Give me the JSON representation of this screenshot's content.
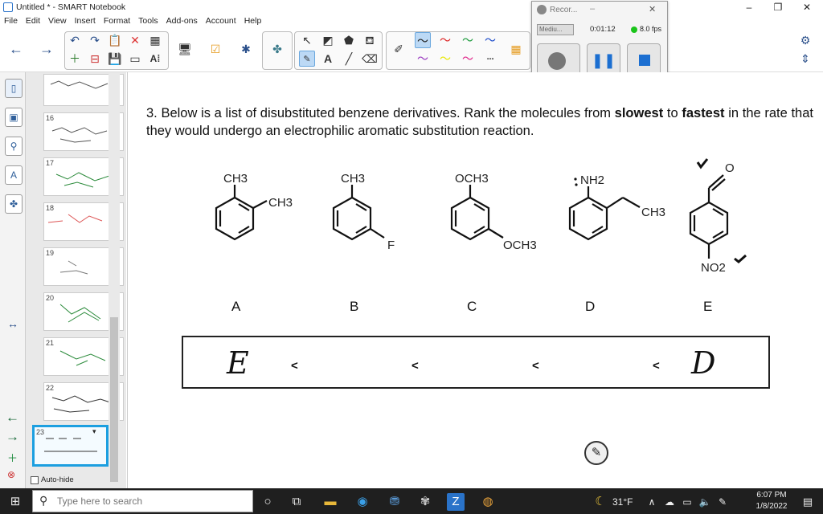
{
  "window": {
    "title": "Untitled * - SMART Notebook",
    "minimize": "–",
    "restore": "❐",
    "close": "✕"
  },
  "menu": [
    "File",
    "Edit",
    "View",
    "Insert",
    "Format",
    "Tools",
    "Add-ons",
    "Account",
    "Help"
  ],
  "recorder": {
    "title": "Recor...",
    "dropdown": "Mediu...",
    "time": "0:01:12",
    "fps": "8.0 fps",
    "minimize": "–",
    "close": "✕"
  },
  "slides": [
    "16",
    "17",
    "18",
    "19",
    "20",
    "21",
    "22",
    "23"
  ],
  "sorter": {
    "autohide_label": "Auto-hide"
  },
  "question": {
    "number": "3.",
    "part1": "Below is a list of disubstituted benzene derivatives. Rank the molecules from",
    "bold1": "slowest",
    "part2": "to",
    "bold2": "fastest",
    "part3": "in the rate that they would undergo an electrophilic aromatic substitution reaction."
  },
  "molecules": [
    {
      "label": "A",
      "sub1": "CH3",
      "sub2": "CH3"
    },
    {
      "label": "B",
      "sub1": "CH3",
      "sub2": "F"
    },
    {
      "label": "C",
      "sub1": "OCH3",
      "sub2": "OCH3"
    },
    {
      "label": "D",
      "sub1": "NH2",
      "sub2": "CH3"
    },
    {
      "label": "E",
      "sub1": "O",
      "sub2": "NO2"
    }
  ],
  "ranking": {
    "separator": "<",
    "first_handwritten": "E",
    "last_handwritten": "D"
  },
  "taskbar": {
    "search_placeholder": "Type here to search",
    "temperature": "31°F",
    "time": "6:07 PM",
    "date": "1/8/2022"
  },
  "colors": {
    "accent": "#1c9fe0",
    "taskbar": "#1f1f1f",
    "selected_tool": "#bcd9f5"
  }
}
